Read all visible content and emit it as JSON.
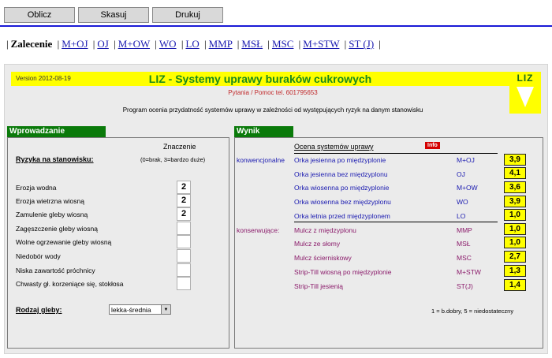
{
  "toolbar": {
    "calc_label": "Oblicz",
    "clear_label": "Skasuj",
    "print_label": "Drukuj"
  },
  "nav": {
    "current": "Zalecenie",
    "links": [
      "M+OJ",
      "OJ",
      "M+OW",
      "WO",
      "LO",
      "MMP",
      "MSŁ",
      "MSC",
      "M+STW",
      "ST (J)"
    ]
  },
  "header": {
    "version": "Version 2012-08-19",
    "title": "LIZ - Systemy uprawy buraków cukrowych",
    "contact": "Pytania / Pomoc tel. 601795653",
    "description": "Program ocenia przydatność systemów uprawy w zależności od występujących ryzyk na danym stanowisku",
    "logo_text": "LIZ"
  },
  "input": {
    "heading": "Wprowadzanie",
    "col_title": "Znaczenie",
    "risks_label": "Ryzyka na stanowisku:",
    "scale_hint": "(0=brak,  3=bardzo duże)",
    "risks": [
      {
        "label": "Erozja wodna",
        "value": "2"
      },
      {
        "label": "Erozja wietrzna wiosną",
        "value": "2"
      },
      {
        "label": "Zamulenie gleby wiosną",
        "value": "2"
      },
      {
        "label": "Zagęszczenie gleby wiosną",
        "value": ""
      },
      {
        "label": "Wolne ogrzewanie gleby wiosną",
        "value": ""
      },
      {
        "label": "Niedobór wody",
        "value": ""
      },
      {
        "label": "Niska zawartość próchnicy",
        "value": ""
      },
      {
        "label": "Chwasty gł. korzeniące się, stokłosa",
        "value": ""
      }
    ],
    "soil_label": "Rodzaj gleby:",
    "soil_value": "lekka-średnia"
  },
  "result": {
    "heading": "Wynik",
    "col_title": "Ocena systemów uprawy",
    "info_label": "Info",
    "group1": "konwencjonalne",
    "group2": "konserwujące:",
    "rows": [
      {
        "name": "Orka jesienna po międzyplonie",
        "code": "M+OJ",
        "score": "3,9"
      },
      {
        "name": "Orka jesienna bez międzyplonu",
        "code": "OJ",
        "score": "4,1"
      },
      {
        "name": "Orka wiosenna po międzyplonie",
        "code": "M+OW",
        "score": "3,6"
      },
      {
        "name": "Orka wiosenna bez międzyplonu",
        "code": "WO",
        "score": "3,9"
      },
      {
        "name": "Orka letnia przed międzyplonem",
        "code": "LO",
        "score": "1,0"
      },
      {
        "name": "Mulcz z międzyplonu",
        "code": "MMP",
        "score": "1,0"
      },
      {
        "name": "Mulcz ze słomy",
        "code": "MSŁ",
        "score": "1,0"
      },
      {
        "name": "Mulcz ścierniskowy",
        "code": "MSC",
        "score": "2,7"
      },
      {
        "name": "Strip-Till wiosną po międzyplonie",
        "code": "M+STW",
        "score": "1,3"
      },
      {
        "name": "Strip-Till jesienią",
        "code": "ST(J)",
        "score": "1,4"
      }
    ],
    "legend": "1 = b.dobry, 5 = niedostateczny"
  },
  "colors": {
    "conventional": "#1a1ab0",
    "conservation": "#8a1a6a",
    "green": "#0a7a0a",
    "yellow": "#ffff00"
  }
}
